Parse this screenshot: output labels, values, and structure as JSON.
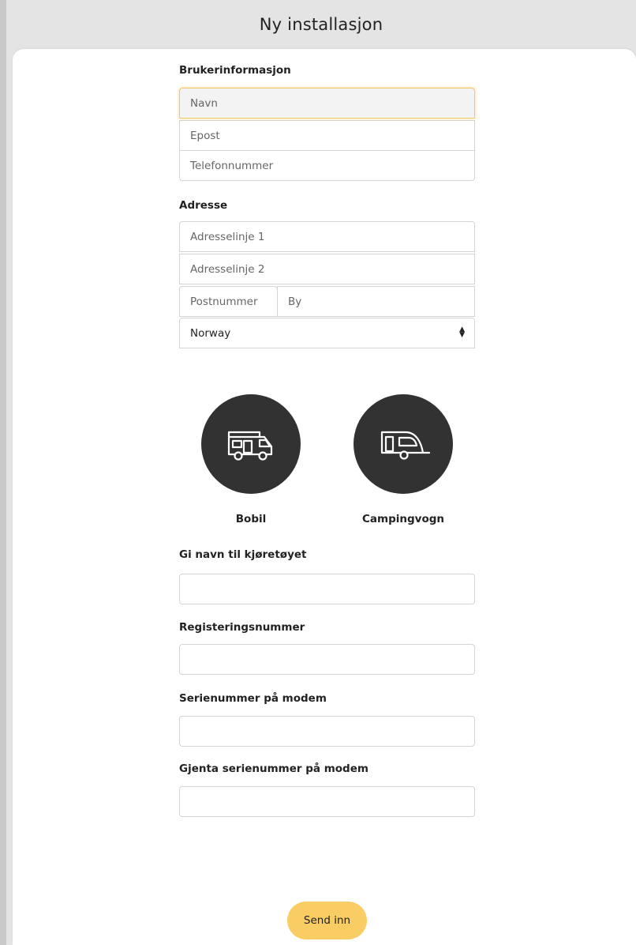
{
  "header": {
    "title": "Ny installasjon"
  },
  "user_info": {
    "label": "Brukerinformasjon",
    "name_placeholder": "Navn",
    "email_placeholder": "Epost",
    "phone_placeholder": "Telefonnummer"
  },
  "address": {
    "label": "Adresse",
    "line1_placeholder": "Adresselinje 1",
    "line2_placeholder": "Adresselinje 2",
    "postal_placeholder": "Postnummer",
    "city_placeholder": "By",
    "country_value": "Norway"
  },
  "vehicle_types": [
    {
      "label": "Bobil",
      "icon": "motorhome-icon"
    },
    {
      "label": "Campingvogn",
      "icon": "caravan-icon"
    }
  ],
  "vehicle_fields": {
    "name_label": "Gi navn til kjøretøyet",
    "name_value": "",
    "registration_label": "Registeringsnummer",
    "registration_value": "",
    "serial_label": "Serienummer på modem",
    "serial_value": "",
    "serial_repeat_label": "Gjenta serienummer på modem",
    "serial_repeat_value": ""
  },
  "submit": {
    "label": "Send inn"
  },
  "colors": {
    "accent": "#f9cd63",
    "icon_bg": "#333232",
    "focus_border": "#f2c66a",
    "page_bg": "#e4e4e4"
  }
}
